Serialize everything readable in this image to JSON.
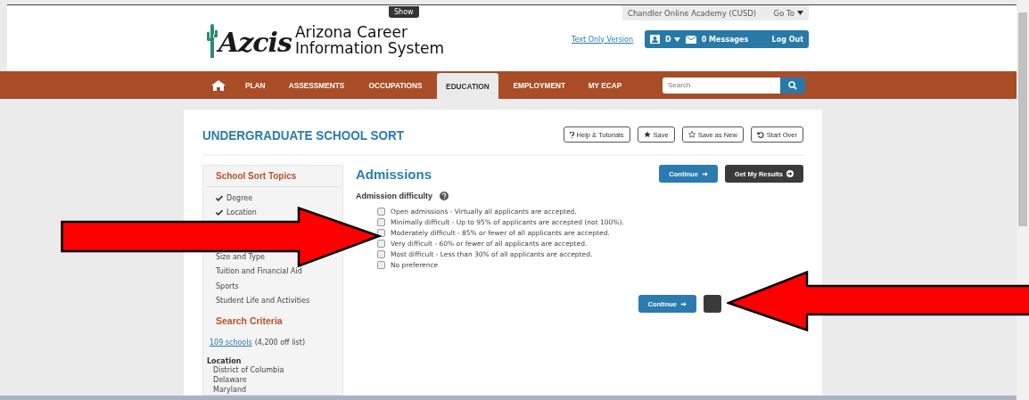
{
  "header": {
    "show_tab": "Show",
    "logo_text": "Azcis",
    "site_title_line1": "Arizona Career",
    "site_title_line2": "Information System",
    "school": "Chandler Online Academy (CUSD)",
    "goto": "Go To",
    "text_only_link": "Text Only Version",
    "user_initial": "D",
    "messages": "0 Messages",
    "logout": "Log Out"
  },
  "nav": {
    "items": [
      {
        "label": "PLAN",
        "selected": false
      },
      {
        "label": "ASSESSMENTS",
        "selected": false
      },
      {
        "label": "OCCUPATIONS",
        "selected": false
      },
      {
        "label": "EDUCATION",
        "selected": true
      },
      {
        "label": "EMPLOYMENT",
        "selected": false
      },
      {
        "label": "MY ECAP",
        "selected": false
      }
    ],
    "search": {
      "placeholder": "Search"
    }
  },
  "page": {
    "title": "UNDERGRADUATE SCHOOL SORT",
    "actions": [
      {
        "label": "Help & Tutorials",
        "kind": "help"
      },
      {
        "label": "Save",
        "kind": "star"
      },
      {
        "label": "Save as New",
        "kind": "star-outline"
      },
      {
        "label": "Start Over",
        "kind": "undo"
      }
    ]
  },
  "sidebar": {
    "topics_title": "School Sort Topics",
    "topics": [
      {
        "label": "Degree",
        "checked": true
      },
      {
        "label": "Location",
        "checked": true
      },
      {
        "label": "Size and Type",
        "checked": false
      },
      {
        "label": "Tuition and Financial Aid",
        "checked": false
      },
      {
        "label": "Sports",
        "checked": false
      },
      {
        "label": "Student Life and Activities",
        "checked": false
      }
    ],
    "criteria_title": "Search Criteria",
    "count_link": "109 schools",
    "count_note": "(4,200 off list)",
    "location_heading": "Location",
    "locations": [
      "District of Columbia",
      "Delaware",
      "Maryland"
    ]
  },
  "main": {
    "title": "Admissions",
    "continue": "Continue",
    "results": "Get My Results",
    "question": "Admission difficulty",
    "options": [
      {
        "label": "Open admissions - Virtually all applicants are accepted.",
        "checked": false
      },
      {
        "label": "Minimally difficult - Up to 95% of applicants are accepted (not 100%).",
        "checked": false
      },
      {
        "label": "Moderately difficult - 85% or fewer of all applicants are accepted.",
        "checked": false
      },
      {
        "label": "Very difficult - 60% or fewer of all applicants are accepted.",
        "checked": false
      },
      {
        "label": "Most difficult - Less than 30% of all applicants are accepted.",
        "checked": false
      },
      {
        "label": "No preference",
        "checked": false
      }
    ],
    "bottom_continue": "Continue"
  }
}
